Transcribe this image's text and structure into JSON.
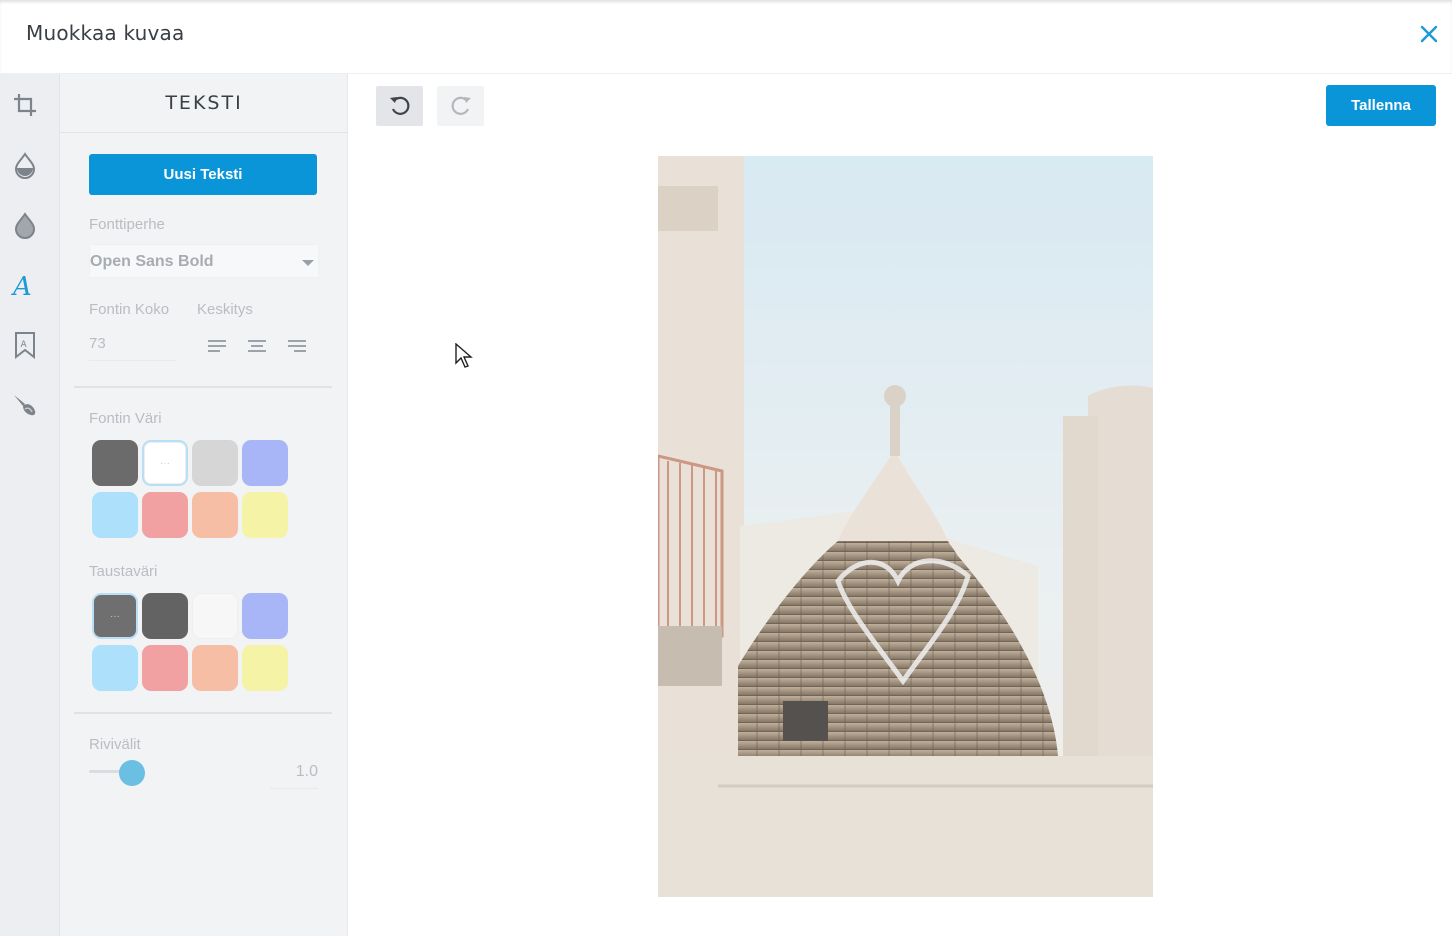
{
  "dialog": {
    "title": "Muokkaa kuvaa",
    "close_icon": "close-icon"
  },
  "tools": [
    {
      "name": "crop",
      "icon": "crop-icon"
    },
    {
      "name": "filters",
      "icon": "drop-outline-icon"
    },
    {
      "name": "adjust",
      "icon": "drop-icon"
    },
    {
      "name": "text",
      "icon": "text-icon",
      "active": true
    },
    {
      "name": "stickers",
      "icon": "bookmark-icon"
    },
    {
      "name": "draw",
      "icon": "brush-icon"
    }
  ],
  "panel": {
    "title": "TEKSTI",
    "new_text_button": "Uusi Teksti",
    "font_family_label": "Fonttiperhe",
    "font_family_value": "Open Sans Bold",
    "font_size_label": "Fontin Koko",
    "alignment_label": "Keskitys",
    "font_size_value": "73",
    "font_color_label": "Fontin Väri",
    "font_colors": [
      "#6b6b6b",
      "#ffffff",
      "#d6d6d6",
      "#a8b6f7",
      "#ade0fb",
      "#f1a1a1",
      "#f6bea5",
      "#f5f3a6"
    ],
    "background_color_label": "Taustaväri",
    "background_colors": [
      "#6f6f6f",
      "#636363",
      "#f7f7f7",
      "#a8b6f7",
      "#ade0fb",
      "#f1a1a1",
      "#f6bea5",
      "#f5f3a6"
    ],
    "line_spacing_label": "Rivivälit",
    "line_spacing_value": "1.0",
    "line_spacing_fraction": 0.2
  },
  "toolbar": {
    "undo_icon": "undo-icon",
    "redo_icon": "redo-icon",
    "save_label": "Tallenna"
  },
  "colors": {
    "accent": "#0b95d9",
    "slider": "#6bbfe3"
  }
}
